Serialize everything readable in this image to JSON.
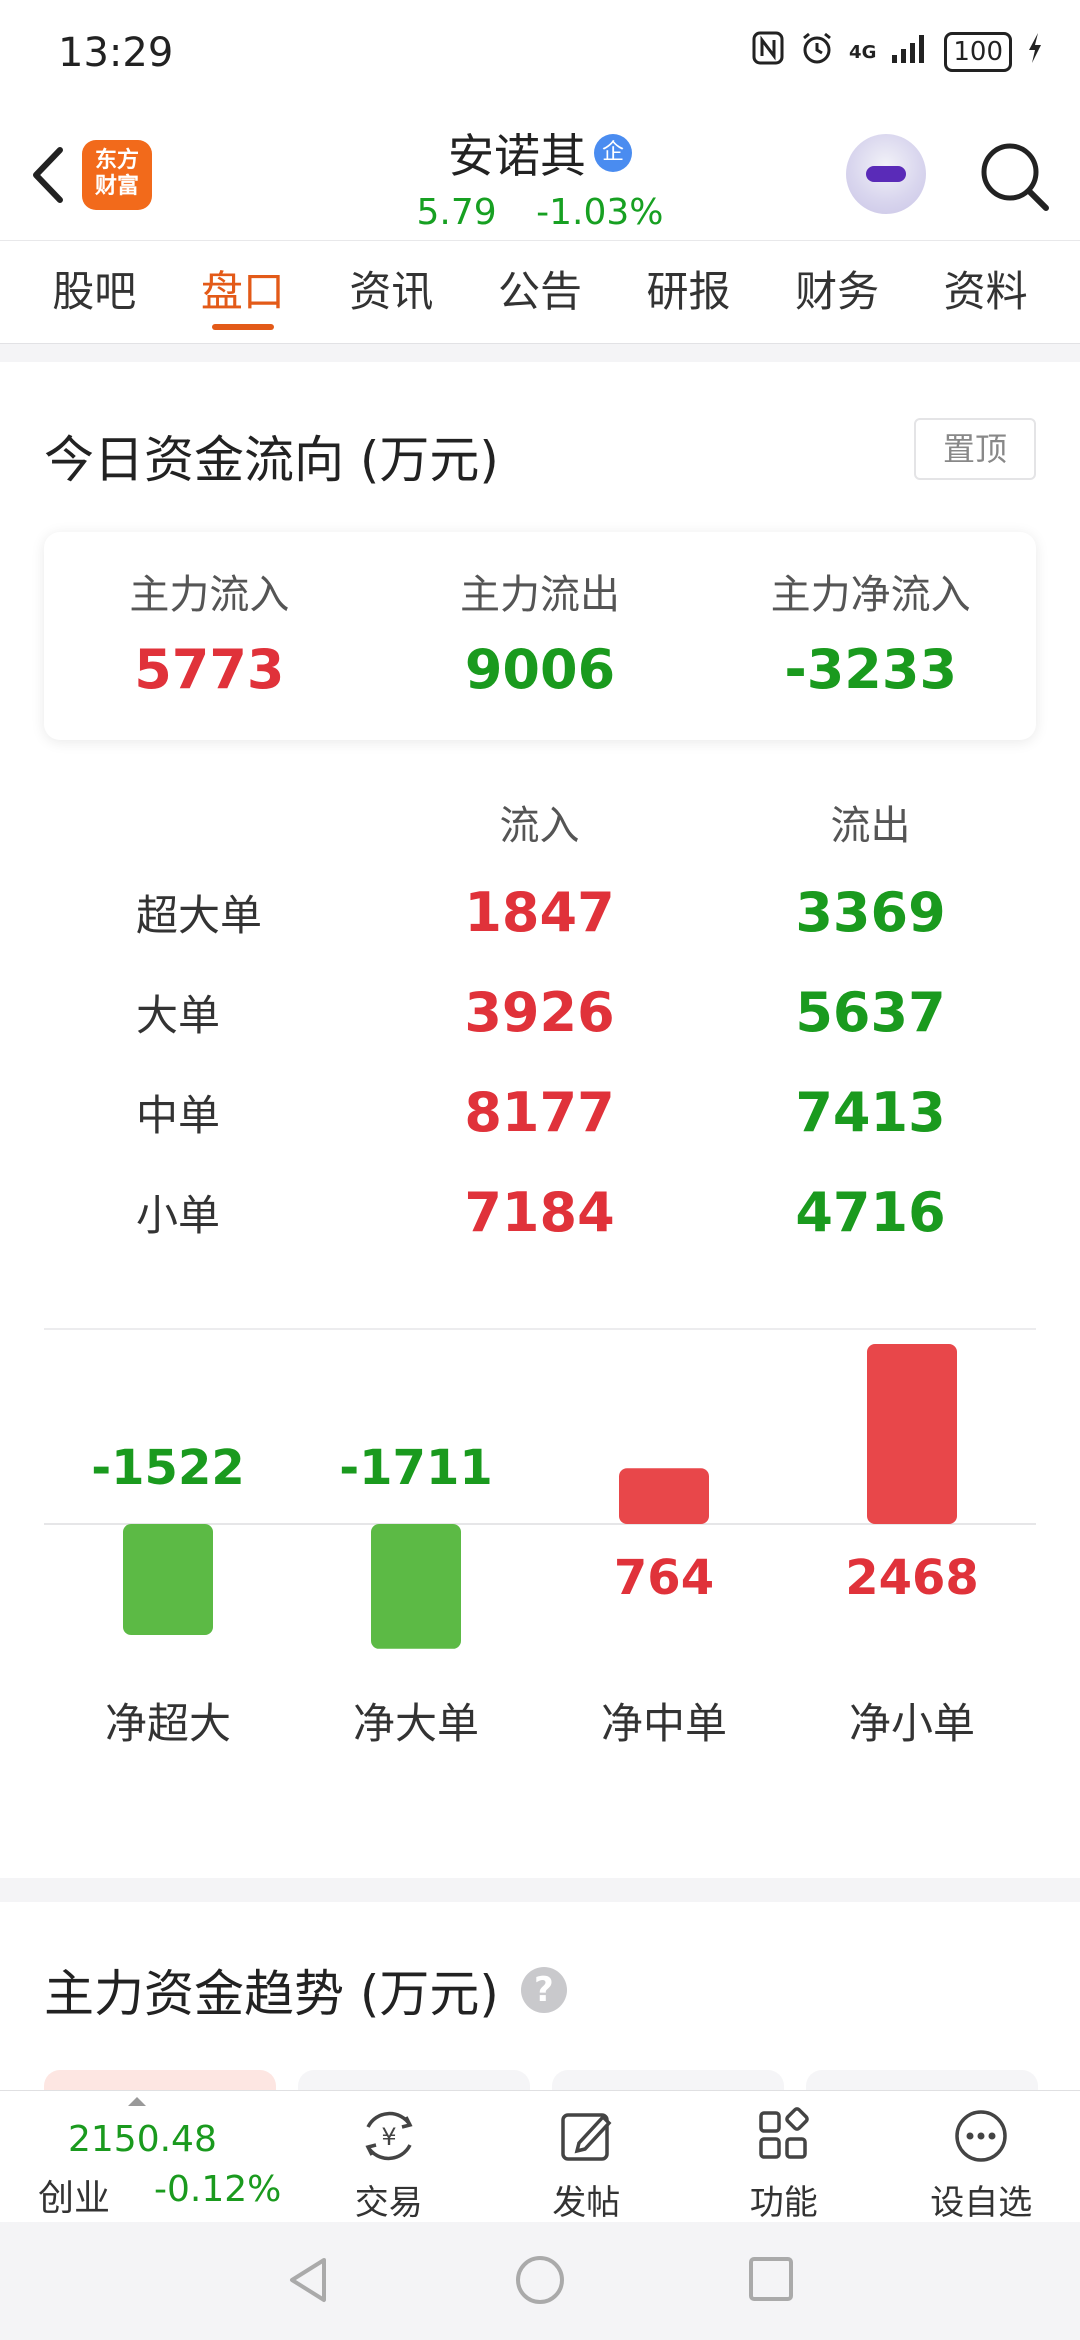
{
  "status_bar": {
    "time": "13:29",
    "network": "4G",
    "battery": "100"
  },
  "header": {
    "logo_line1": "东方",
    "logo_line2": "财富",
    "stock_name": "安诺其",
    "badge": "企",
    "price": "5.79",
    "change_pct": "-1.03%"
  },
  "tabs": [
    "股吧",
    "盘口",
    "资讯",
    "公告",
    "研报",
    "财务",
    "资料"
  ],
  "active_tab": "盘口",
  "fund_flow": {
    "title": "今日资金流向 (万元)",
    "pin_label": "置顶",
    "summary": [
      {
        "label": "主力流入",
        "value": "5773",
        "color": "red"
      },
      {
        "label": "主力流出",
        "value": "9006",
        "color": "green"
      },
      {
        "label": "主力净流入",
        "value": "-3233",
        "color": "green"
      }
    ],
    "table_headers": {
      "in": "流入",
      "out": "流出"
    },
    "rows": [
      {
        "name": "超大单",
        "in": "1847",
        "out": "3369"
      },
      {
        "name": "大单",
        "in": "3926",
        "out": "5637"
      },
      {
        "name": "中单",
        "in": "8177",
        "out": "7413"
      },
      {
        "name": "小单",
        "in": "7184",
        "out": "4716"
      }
    ]
  },
  "chart_data": {
    "type": "bar",
    "categories": [
      "净超大",
      "净大单",
      "净中单",
      "净小单"
    ],
    "values": [
      -1522,
      -1711,
      764,
      2468
    ],
    "value_labels": [
      "-1522",
      "-1711",
      "764",
      "2468"
    ],
    "positive_color": "#e8474a",
    "negative_color": "#5cba45",
    "title": "",
    "xlabel": "",
    "ylabel": ""
  },
  "trend": {
    "title": "主力资金趋势 (万元)",
    "help": "?"
  },
  "bottom_bar": {
    "index_value": "2150.48",
    "index_name": "创业",
    "index_change": "-0.12%",
    "items": [
      {
        "label": "交易",
        "icon": "trade-icon"
      },
      {
        "label": "发帖",
        "icon": "post-icon"
      },
      {
        "label": "功能",
        "icon": "function-icon"
      },
      {
        "label": "设自选",
        "icon": "more-icon"
      }
    ]
  }
}
